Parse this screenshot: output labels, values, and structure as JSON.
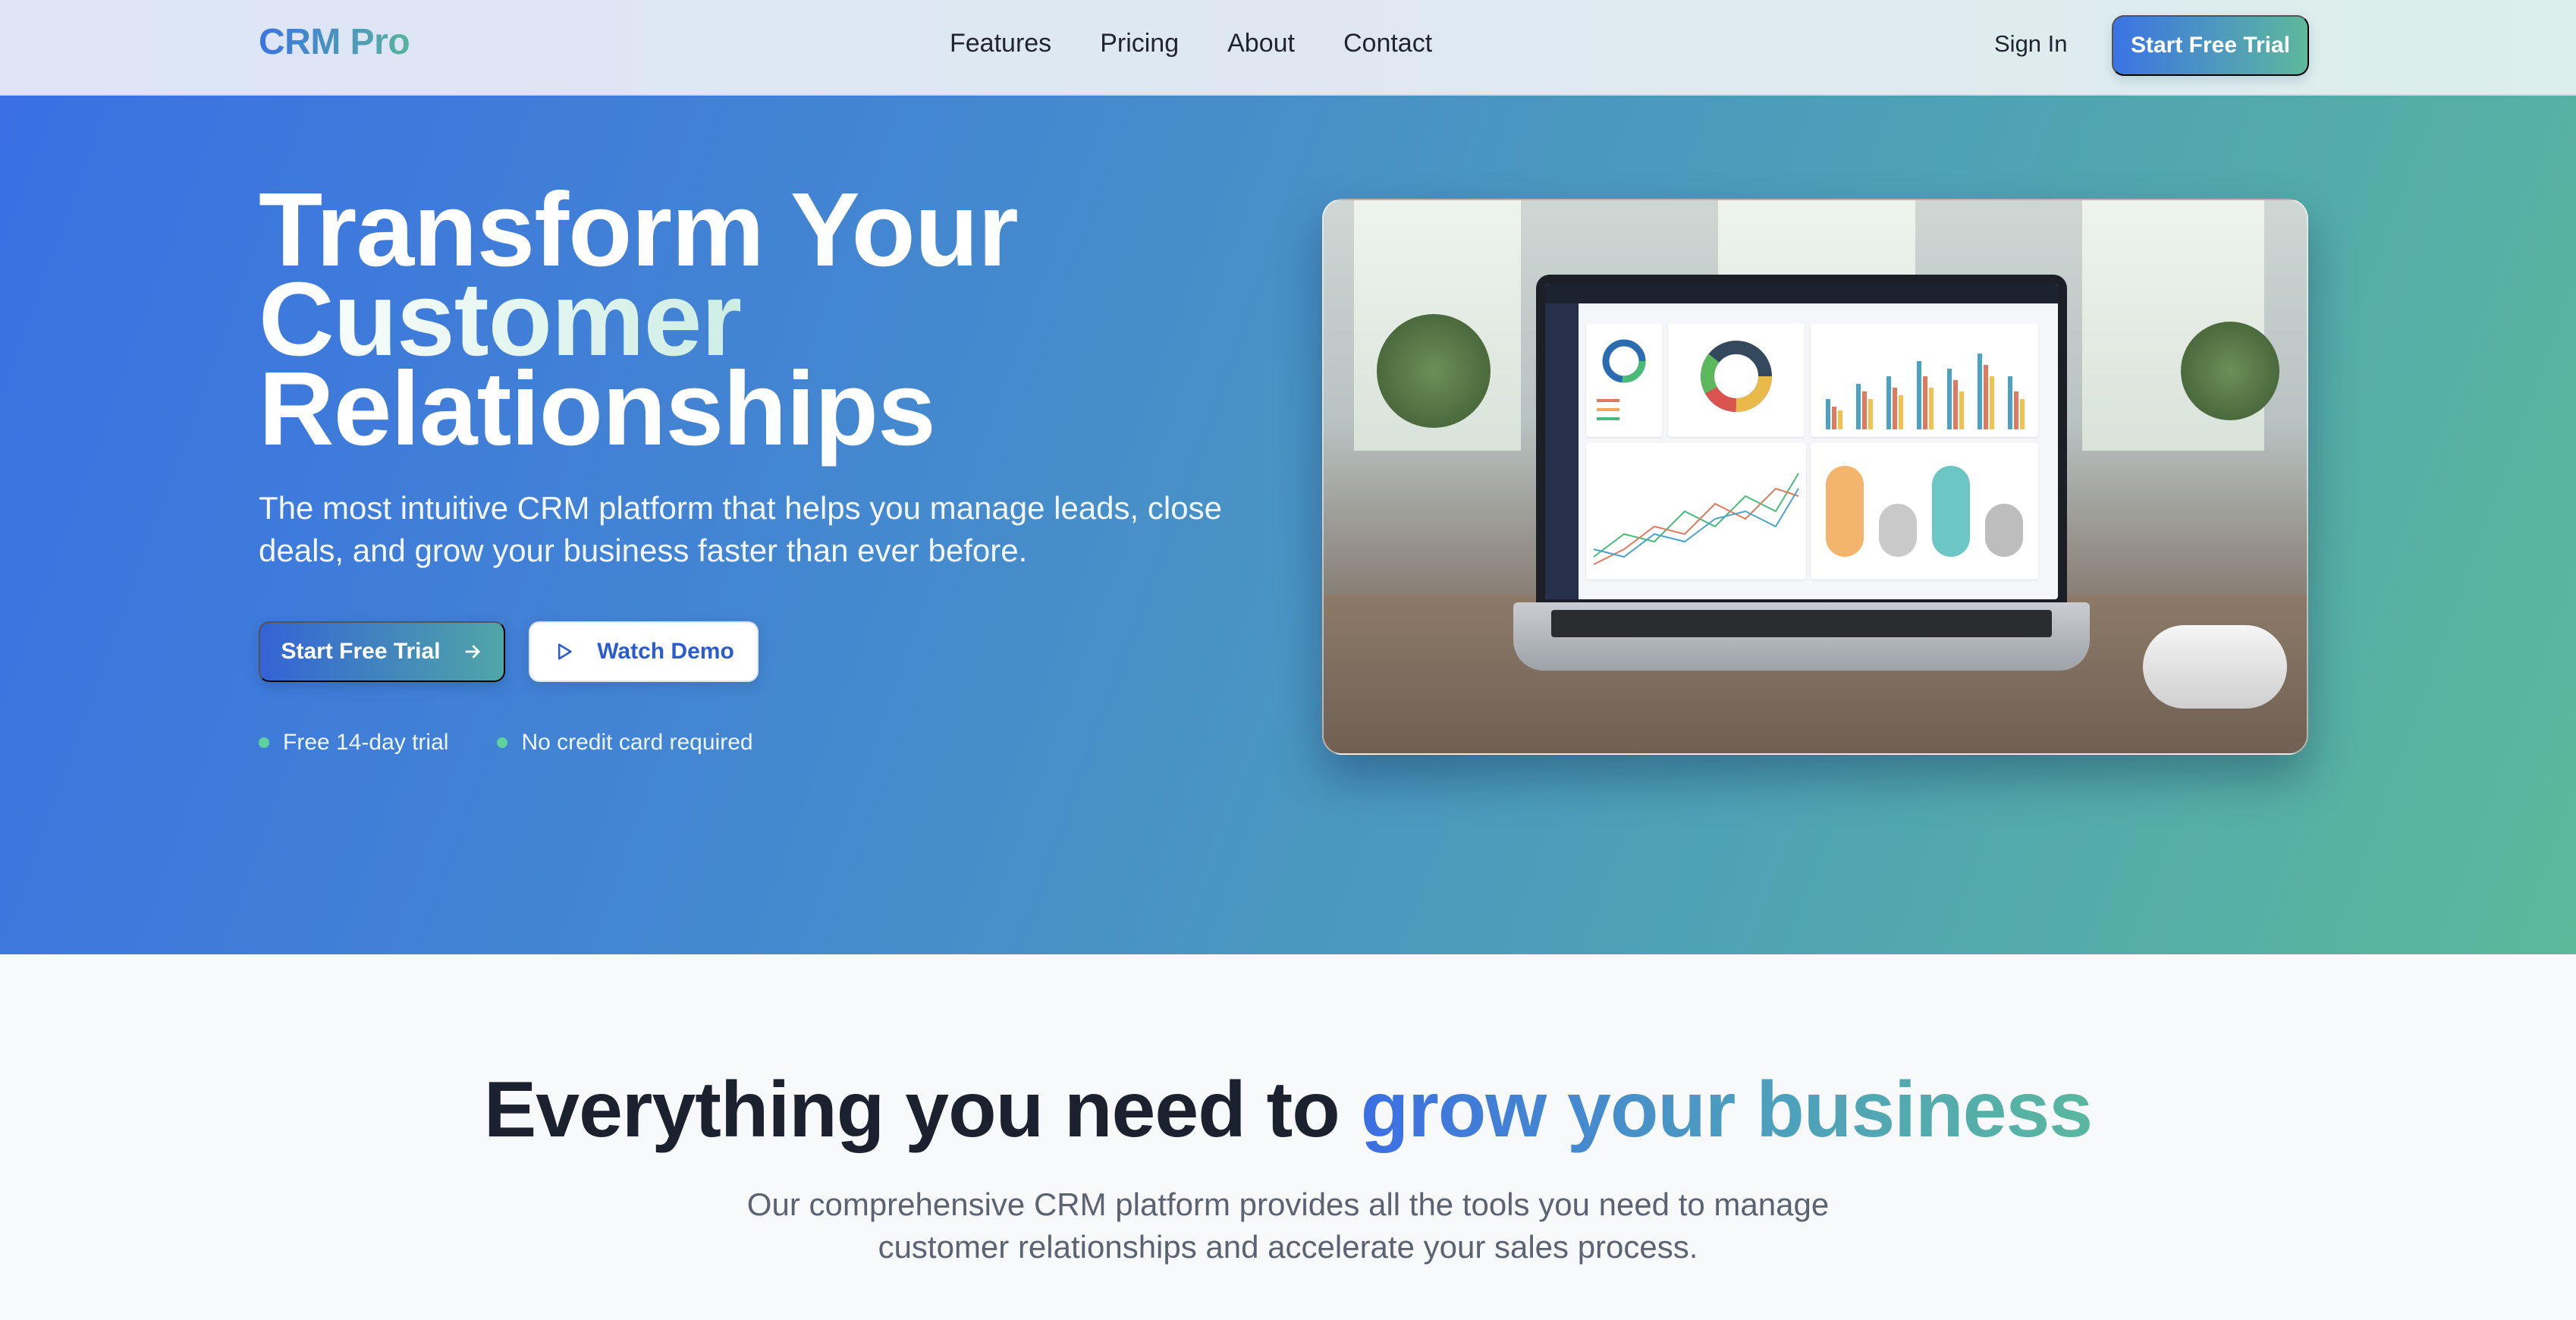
{
  "nav": {
    "logo": "CRM Pro",
    "links": [
      "Features",
      "Pricing",
      "About",
      "Contact"
    ],
    "sign_in": "Sign In",
    "cta": "Start Free Trial"
  },
  "hero": {
    "title_line1": "Transform Your",
    "title_accent": "Customer",
    "title_line3": "Relationships",
    "subtitle": "The most intuitive CRM platform that helps you manage leads, close deals, and grow your business faster than ever before.",
    "primary_button": "Start Free Trial",
    "secondary_button": "Watch Demo",
    "perks": [
      "Free 14-day trial",
      "No credit card required"
    ]
  },
  "features": {
    "title_prefix": "Everything you need to ",
    "title_highlight": "grow your business",
    "subtitle": "Our comprehensive CRM platform provides all the tools you need to manage customer relationships and accelerate your sales process."
  },
  "icons": {
    "primary_button_icon": "arrow-right-icon",
    "secondary_button_icon": "play-icon",
    "perk_icon": "green-dot-icon"
  },
  "colors": {
    "brand_blue": "#3a74e0",
    "brand_teal": "#5db89c",
    "perk_dot": "#5fd29b"
  }
}
